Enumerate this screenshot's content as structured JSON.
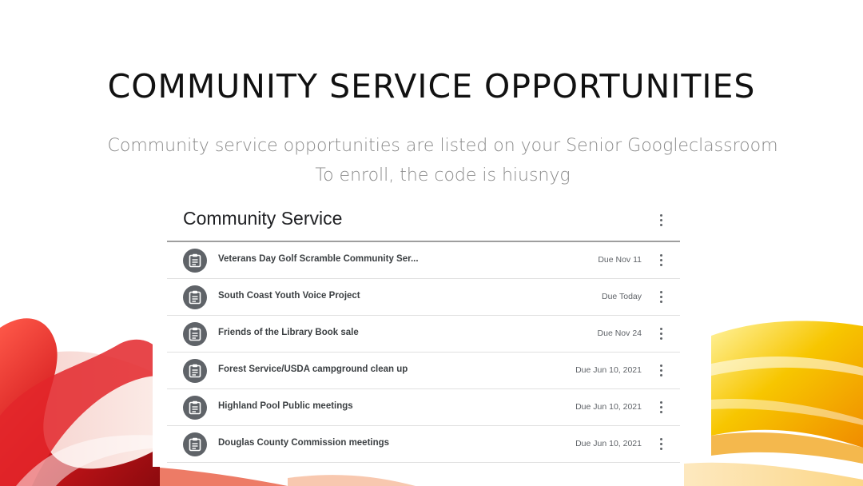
{
  "slide": {
    "title": "COMMUNITY SERVICE OPPORTUNITIES",
    "subtitle_line1": "Community service opportunities are listed on your Senior Googleclassroom",
    "subtitle_line2": "To enroll, the code is hiusnyg"
  },
  "classroom": {
    "topic_title": "Community Service",
    "topic_menu_icon": "more-vert-icon",
    "assignment_icon": "assignment-icon",
    "items": [
      {
        "title": "Veterans Day Golf Scramble Community Ser...",
        "due": "Due Nov 11"
      },
      {
        "title": "South Coast Youth Voice Project",
        "due": "Due Today"
      },
      {
        "title": "Friends of the Library Book sale",
        "due": "Due Nov 24"
      },
      {
        "title": "Forest Service/USDA campground clean up",
        "due": "Due Jun 10, 2021"
      },
      {
        "title": "Highland Pool Public meetings",
        "due": "Due Jun 10, 2021"
      },
      {
        "title": "Douglas County Commission meetings",
        "due": "Due Jun 10, 2021"
      }
    ]
  },
  "colors": {
    "accent_red": "#d0161b",
    "accent_yellow": "#f7c600",
    "icon_gray": "#5f6368"
  }
}
